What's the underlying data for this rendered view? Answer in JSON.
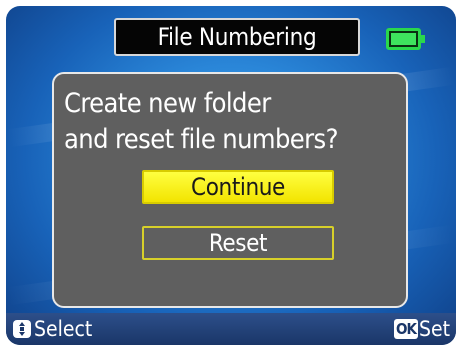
{
  "header": {
    "title": "File Numbering"
  },
  "dialog": {
    "message_line1": "Create new folder",
    "message_line2": "and reset file numbers?",
    "options": {
      "continue_label": "Continue",
      "reset_label": "Reset"
    },
    "selected_option": "Continue"
  },
  "footer": {
    "select_hint": "Select",
    "ok_icon_label": "OK",
    "set_hint": "Set"
  },
  "status": {
    "battery_level": 1.0,
    "battery_icon": "battery-full-icon"
  },
  "colors": {
    "background_blue": "#2a86d8",
    "dialog_gray": "#5f5f5f",
    "selected_yellow": "#f2e400",
    "battery_green": "#2ad84c"
  }
}
